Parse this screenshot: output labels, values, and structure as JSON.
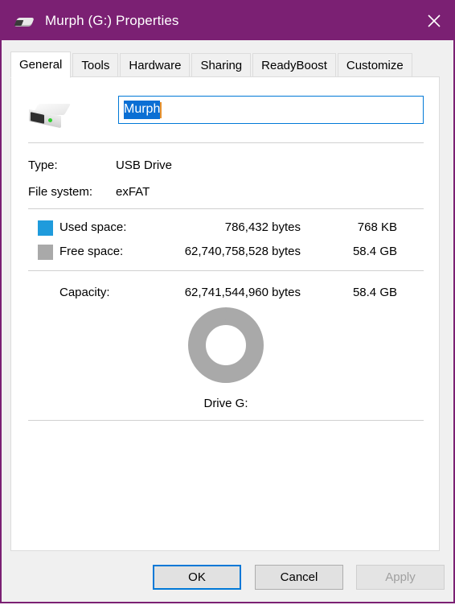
{
  "window": {
    "title": "Murph (G:) Properties",
    "icon": "usb-drive-icon",
    "close_label": "✕",
    "titlebar_color": "#7B2073"
  },
  "tabs": [
    {
      "label": "General",
      "active": true
    },
    {
      "label": "Tools",
      "active": false
    },
    {
      "label": "Hardware",
      "active": false
    },
    {
      "label": "Sharing",
      "active": false
    },
    {
      "label": "ReadyBoost",
      "active": false
    },
    {
      "label": "Customize",
      "active": false
    }
  ],
  "general": {
    "volume_label": {
      "value": "Murph",
      "placeholder": "",
      "selected": true
    },
    "drive_icon": "usb-drive-icon",
    "info": [
      {
        "key": "Type:",
        "value": "USB Drive"
      },
      {
        "key": "File system:",
        "value": "exFAT"
      }
    ],
    "space": [
      {
        "swatch_color": "#1F9BDC",
        "label": "Used space:",
        "bytes": "786,432 bytes",
        "human": "768 KB"
      },
      {
        "swatch_color": "#A9A9A9",
        "label": "Free space:",
        "bytes": "62,740,758,528 bytes",
        "human": "58.4 GB"
      }
    ],
    "capacity": {
      "label": "Capacity:",
      "bytes": "62,741,544,960 bytes",
      "human": "58.4 GB"
    },
    "drive_caption": "Drive G:"
  },
  "chart_data": {
    "type": "pie",
    "title": "Drive G:",
    "labels": [
      "Used space",
      "Free space"
    ],
    "values": [
      786432,
      62740758528
    ],
    "percentages": [
      0.001,
      99.999
    ],
    "colors": [
      "#1F9BDC",
      "#A9A9A9"
    ],
    "units": "bytes",
    "total": 62741544960,
    "donut": true,
    "legend": "left"
  },
  "buttons": {
    "ok": "OK",
    "cancel": "Cancel",
    "apply": "Apply",
    "apply_disabled": true
  }
}
